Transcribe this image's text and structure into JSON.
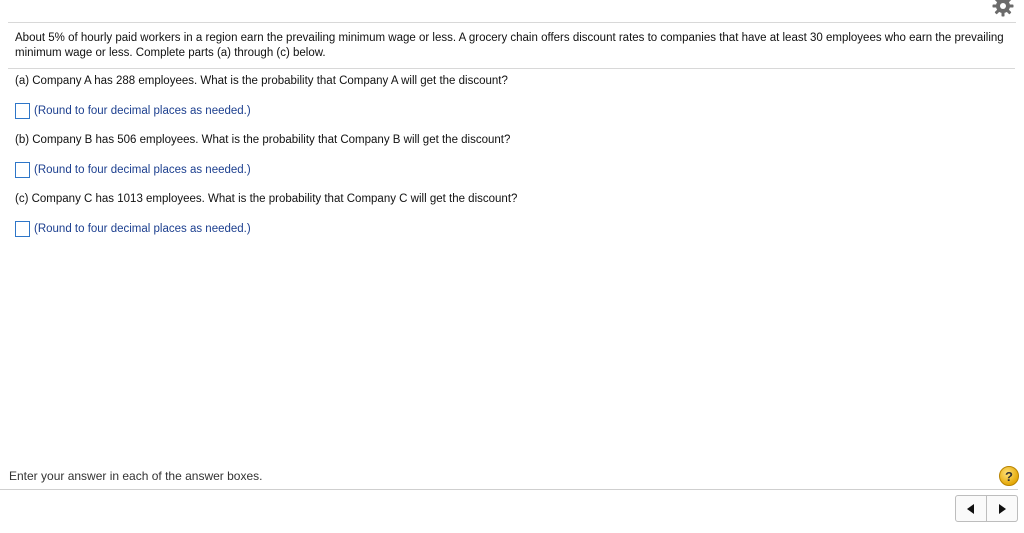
{
  "question": {
    "intro": "About 5% of hourly paid workers in a region earn the prevailing minimum wage or less. A grocery chain offers discount rates to companies that have at least 30 employees who earn the prevailing minimum wage or less. Complete parts (a) through (c) below."
  },
  "parts": [
    {
      "prompt": "(a) Company A has 288 employees. What is the probability that Company A will get the discount?",
      "answer_value": "",
      "hint": "(Round to four decimal places as needed.)"
    },
    {
      "prompt": "(b) Company B has 506 employees. What is the probability that Company B will get the discount?",
      "answer_value": "",
      "hint": "(Round to four decimal places as needed.)"
    },
    {
      "prompt": "(c) Company C has 1013 employees. What is the probability that Company C will get the discount?",
      "answer_value": "",
      "hint": "(Round to four decimal places as needed.)"
    }
  ],
  "footer": {
    "instruction": "Enter your answer in each of the answer boxes.",
    "help_label": "?"
  },
  "icons": {
    "settings": "gear-icon",
    "help": "help-icon",
    "prev": "arrow-left-icon",
    "next": "arrow-right-icon"
  },
  "colors": {
    "hint_text": "#1c3f8f",
    "answer_box_border": "#2e76c8",
    "help_badge": "#e5a90a"
  }
}
